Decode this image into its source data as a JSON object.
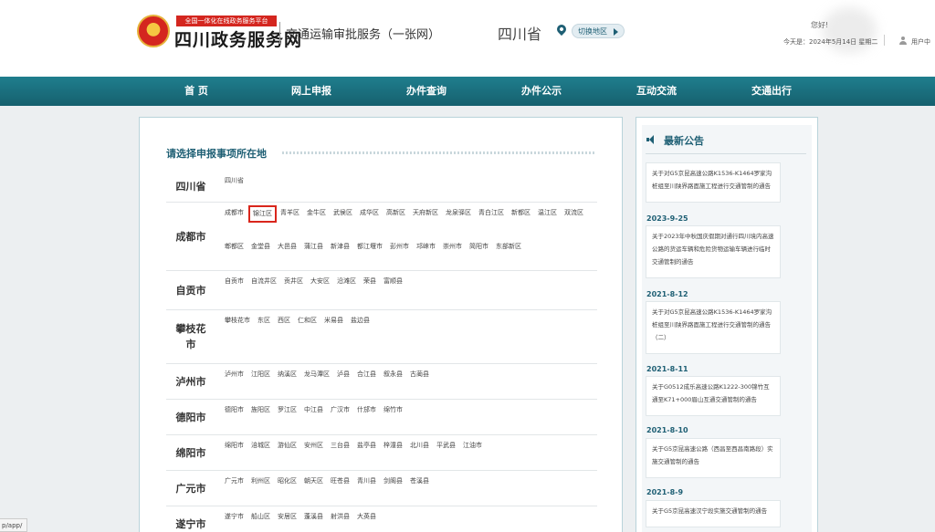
{
  "header": {
    "logo_sub": "全国一体化在线政务服务平台",
    "logo_title": "四川政务服务网",
    "service_name": "交通运输审批服务（一张网）",
    "province": "四川省",
    "switch_region": "切换地区",
    "greeting": "您好!",
    "date": "今天是：2024年5月14日 星期二",
    "user_center": "用户中"
  },
  "nav": {
    "items": [
      "首 页",
      "网上申报",
      "办件查询",
      "办件公示",
      "互动交流",
      "交通出行"
    ]
  },
  "main": {
    "section_title": "请选择申报事项所在地",
    "rows": [
      {
        "name": "四川省",
        "items": [
          "四川省"
        ]
      },
      {
        "name": "成都市",
        "items": [
          "成都市",
          "锦江区",
          "青羊区",
          "金牛区",
          "武侯区",
          "成华区",
          "高新区",
          "天府新区",
          "龙泉驿区",
          "青白江区",
          "新都区",
          "温江区",
          "双流区",
          "郫都区",
          "金堂县",
          "大邑县",
          "蒲江县",
          "新津县",
          "都江堰市",
          "彭州市",
          "邛崃市",
          "崇州市",
          "简阳市",
          "东部新区"
        ],
        "selected": "锦江区"
      },
      {
        "name": "自贡市",
        "items": [
          "自贡市",
          "自流井区",
          "贡井区",
          "大安区",
          "沿滩区",
          "荣县",
          "富顺县"
        ]
      },
      {
        "name": "攀枝花市",
        "items": [
          "攀枝花市",
          "东区",
          "西区",
          "仁和区",
          "米易县",
          "盐边县"
        ]
      },
      {
        "name": "泸州市",
        "items": [
          "泸州市",
          "江阳区",
          "纳溪区",
          "龙马潭区",
          "泸县",
          "合江县",
          "叙永县",
          "古蔺县"
        ]
      },
      {
        "name": "德阳市",
        "items": [
          "德阳市",
          "旌阳区",
          "罗江区",
          "中江县",
          "广汉市",
          "什邡市",
          "绵竹市"
        ]
      },
      {
        "name": "绵阳市",
        "items": [
          "绵阳市",
          "涪城区",
          "游仙区",
          "安州区",
          "三台县",
          "盐亭县",
          "梓潼县",
          "北川县",
          "平武县",
          "江油市"
        ]
      },
      {
        "name": "广元市",
        "items": [
          "广元市",
          "利州区",
          "昭化区",
          "朝天区",
          "旺苍县",
          "青川县",
          "剑阁县",
          "苍溪县"
        ]
      },
      {
        "name": "遂宁市",
        "items": [
          "遂宁市",
          "船山区",
          "安居区",
          "蓬溪县",
          "射洪县",
          "大英县"
        ]
      }
    ]
  },
  "sidebar": {
    "title": "最新公告",
    "notices": [
      {
        "date": "",
        "text": "关于对G5京昆高速公路K1536-K1464罗家沟桩组至川陕界路面施工程进行交通管制的通告"
      },
      {
        "date": "2023-9-25",
        "text": "关于2023年中秋国庆假期对通行四川境内高速公路的货运车辆和危险货物运输车辆进行临时交通管制的通告"
      },
      {
        "date": "2021-8-12",
        "text": "关于对G5京昆高速公路K1536-K1464罗家沟桩组至川陕界路面施工程进行交通管制的通告（二）"
      },
      {
        "date": "2021-8-11",
        "text": "关于G0512成乐高速公路K1222-300锦竹互通至K71+000眉山互通交通管制的通告"
      },
      {
        "date": "2021-8-10",
        "text": "关于G5京昆高速公路（西昌至西昌南路段）实施交通管制的通告"
      },
      {
        "date": "2021-8-9",
        "text": "关于G5京昆高速汉宁段实施交通管制的通告"
      }
    ]
  },
  "status_url": "p/app/"
}
